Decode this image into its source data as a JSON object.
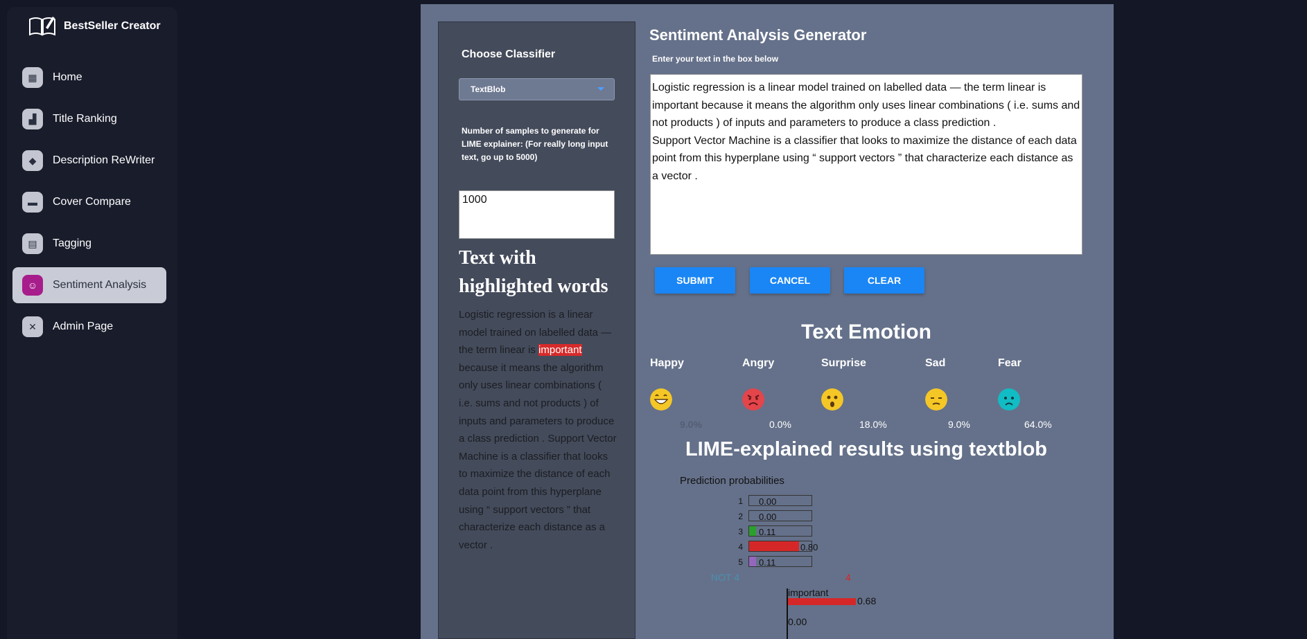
{
  "brand": {
    "name": "BestSeller Creator",
    "icon": "book-icon"
  },
  "sidebar": {
    "items": [
      {
        "label": "Home",
        "icon": "store-icon"
      },
      {
        "label": "Title Ranking",
        "icon": "bar-chart-icon"
      },
      {
        "label": "Description ReWriter",
        "icon": "cube-icon"
      },
      {
        "label": "Cover Compare",
        "icon": "card-icon"
      },
      {
        "label": "Tagging",
        "icon": "document-icon"
      },
      {
        "label": "Sentiment Analysis",
        "icon": "user-sentiment-icon",
        "active": true
      },
      {
        "label": "Admin Page",
        "icon": "tools-icon"
      }
    ]
  },
  "classifier": {
    "label": "Choose Classifier",
    "selected": "TextBlob",
    "samples_note": "Number of samples to generate for LIME explainer: (For really long input text, go up to 5000)",
    "samples_value": "1000"
  },
  "highlighted": {
    "title": "Text with highlighted words",
    "before": "Logistic regression is a linear model trained on labelled data — the term linear is ",
    "mark": "important",
    "after": " because it means the algorithm only uses linear combinations ( i.e. sums and not products ) of inputs and parameters to produce a class prediction .  Support Vector Machine is a classifier that looks to maximize the distance of each data point from this hyperplane using “ support vectors ” that characterize each distance as a vector ."
  },
  "generator": {
    "title": "Sentiment Analysis Generator",
    "subtitle": "Enter your text in the box below",
    "text_line1": "Logistic regression is a linear model trained on labelled data — the term linear is important because it means the algorithm only uses linear combinations ( i.e. sums and not products ) of inputs and parameters to produce a class prediction .",
    "text_line2": " Support Vector Machine is a classifier that looks to maximize the distance of each data point from this hyperplane using “ support vectors ” that characterize each distance as a vector .",
    "buttons": {
      "submit": "SUBMIT",
      "cancel": "CANCEL",
      "clear": "CLEAR"
    }
  },
  "emotion": {
    "title": "Text Emotion",
    "items": [
      {
        "label": "Happy",
        "value": "9.0%",
        "icon": "grin-emoji-icon"
      },
      {
        "label": "Angry",
        "value": "0.0%",
        "icon": "angry-emoji-icon"
      },
      {
        "label": "Surprise",
        "value": "18.0%",
        "icon": "surprise-emoji-icon"
      },
      {
        "label": "Sad",
        "value": "9.0%",
        "icon": "sad-emoji-icon"
      },
      {
        "label": "Fear",
        "value": "64.0%",
        "icon": "fear-emoji-icon"
      }
    ]
  },
  "lime": {
    "title": "LIME-explained results using textblob",
    "pp_title": "Prediction probabilities",
    "neg_label": "NOT 4",
    "pos_label": "4",
    "feature": {
      "word": "important",
      "value": "0.68"
    },
    "next_value": "0.00",
    "colors": {
      "class1": "#1f77b4",
      "class3": "#2ca02c",
      "class4": "#d62728",
      "class5": "#9467bd"
    }
  },
  "chart_data": {
    "type": "bar",
    "title": "Prediction probabilities",
    "categories": [
      "1",
      "2",
      "3",
      "4",
      "5"
    ],
    "values": [
      0.0,
      0.0,
      0.11,
      0.8,
      0.11
    ],
    "xlim": [
      0,
      1
    ]
  }
}
